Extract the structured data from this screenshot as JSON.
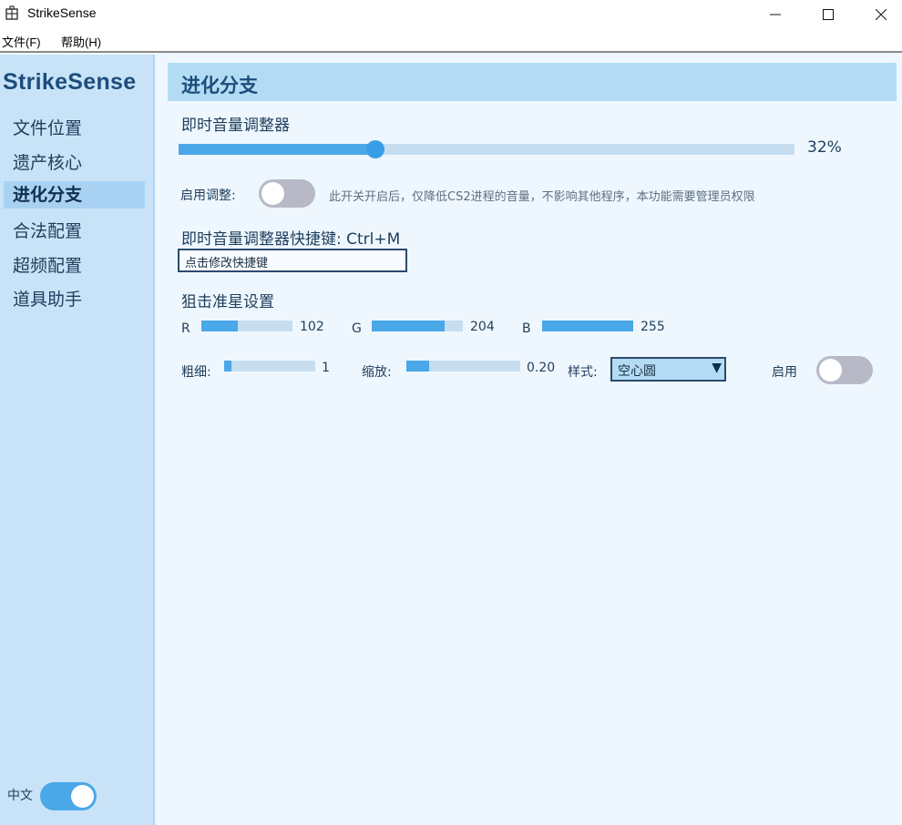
{
  "window": {
    "title": "StrikeSense"
  },
  "menu": {
    "file": "文件(F)",
    "help": "帮助(H)"
  },
  "sidebar": {
    "brand": "StrikeSense",
    "items": [
      "文件位置",
      "遗产核心",
      "进化分支",
      "合法配置",
      "超频配置",
      "道具助手"
    ],
    "active_index": 2,
    "lang_label": "中文",
    "lang_toggle_on": true
  },
  "section": {
    "title": "进化分支"
  },
  "volume": {
    "label": "即时音量调整器",
    "value": 0.32,
    "value_text": "32%",
    "enable_label": "启用调整:",
    "enable_on": false,
    "hint": "此开关开启后，仅降低CS2进程的音量，不影响其他程序，本功能需要管理员权限"
  },
  "hotkey": {
    "label": "即时音量调整器快捷键: Ctrl+M",
    "button": "点击修改快捷键"
  },
  "crosshair": {
    "label": "狙击准星设置",
    "r": {
      "label": "R",
      "value": 102,
      "value_text": "102",
      "max": 255
    },
    "g": {
      "label": "G",
      "value": 204,
      "value_text": "204",
      "max": 255
    },
    "b": {
      "label": "B",
      "value": 255,
      "value_text": "255",
      "max": 255
    },
    "thickness": {
      "label": "粗细:",
      "value_text": "1",
      "fraction": 0.08
    },
    "scale": {
      "label": "缩放:",
      "value_text": "0.20",
      "fraction": 0.2
    },
    "style": {
      "label": "样式:",
      "selected": "空心圆",
      "arrow": "▼"
    },
    "enable": {
      "label": "启用",
      "on": false
    }
  },
  "colors": {
    "accent": "#4aa7e8",
    "sidebar_bg": "#c8e3f7",
    "header_bg": "#b3dcf4",
    "text_dark": "#1d4d7c"
  },
  "icons": {
    "app": "building-icon",
    "minimize": "minimize-icon",
    "maximize": "maximize-icon",
    "close": "close-icon"
  }
}
